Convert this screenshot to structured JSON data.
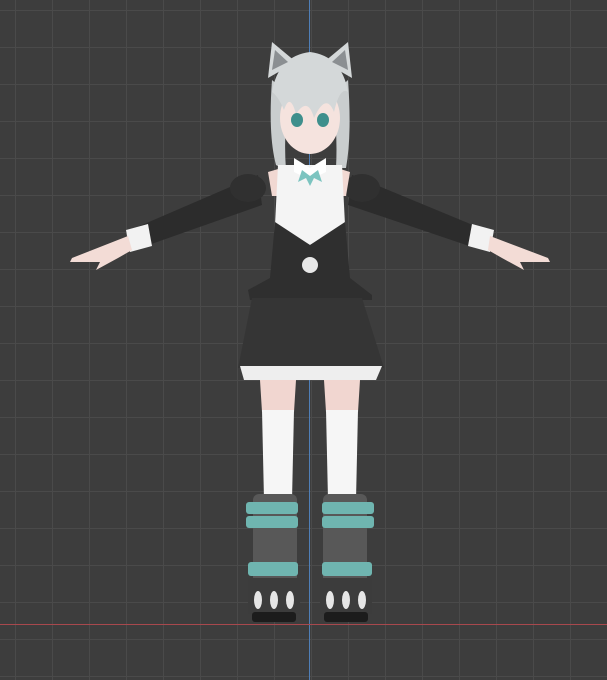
{
  "viewport": {
    "view": "front-orthographic",
    "grid_visible": true,
    "colors": {
      "background": "#3d3d3d",
      "grid": "#4a4a4a",
      "axis_y": "#4f7fb8",
      "axis_x": "#a8484d"
    }
  },
  "model": {
    "subject": "anime-girl-tpose",
    "colors": {
      "hair": "#cfd3d4",
      "dress": "#2f2f2f",
      "shirt": "#f4f4f4",
      "boots": "#5a5a5a",
      "boot_accent": "#6fb5b0",
      "ribbon": "#7cc4c0"
    }
  }
}
